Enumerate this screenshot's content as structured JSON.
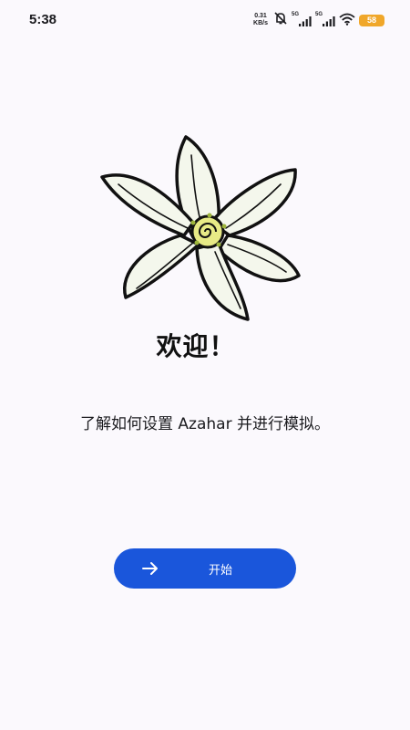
{
  "status_bar": {
    "time": "5:38",
    "net_speed_value": "0.31",
    "net_speed_unit": "KB/s",
    "signal_1_label": "5G",
    "signal_2_label": "5G",
    "battery_level": "58",
    "icons": [
      "mute-icon",
      "signal-icon",
      "signal-icon",
      "wifi-icon",
      "battery-icon"
    ]
  },
  "welcome": {
    "logo_icon": "azahar-flower-icon",
    "title": "欢迎！",
    "subtitle": "了解如何设置 Azahar 并进行模拟。"
  },
  "start_button": {
    "icon": "arrow-right-icon",
    "label": "开始",
    "color": "#1a56db"
  }
}
